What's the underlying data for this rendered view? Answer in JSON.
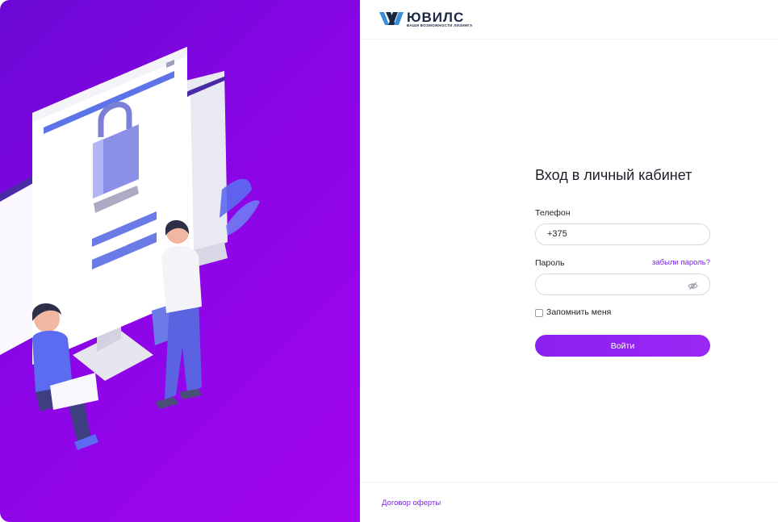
{
  "brand": {
    "name": "ЮВИЛС",
    "tagline": "ВАШИ ВОЗМОЖНОСТИ ЛИЗИНГА"
  },
  "illustration": {
    "password_mask": "*****"
  },
  "login": {
    "title": "Вход в личный кабинет",
    "phone_label": "Телефон",
    "phone_value": "+375",
    "password_label": "Пароль",
    "password_value": "",
    "forgot_link": "забыли пароль?",
    "remember_label": "Запомнить меня",
    "submit_label": "Войти"
  },
  "footer": {
    "offer_link": "Договор оферты"
  },
  "colors": {
    "accent": "#8a20f0",
    "panel_gradient_start": "#6a08d4",
    "panel_gradient_end": "#a205f0",
    "brand_dark": "#1b2640",
    "brand_blue": "#3b8fd8"
  },
  "icons": {
    "password_toggle": "eye-off-icon",
    "brand": "logo-mark"
  }
}
